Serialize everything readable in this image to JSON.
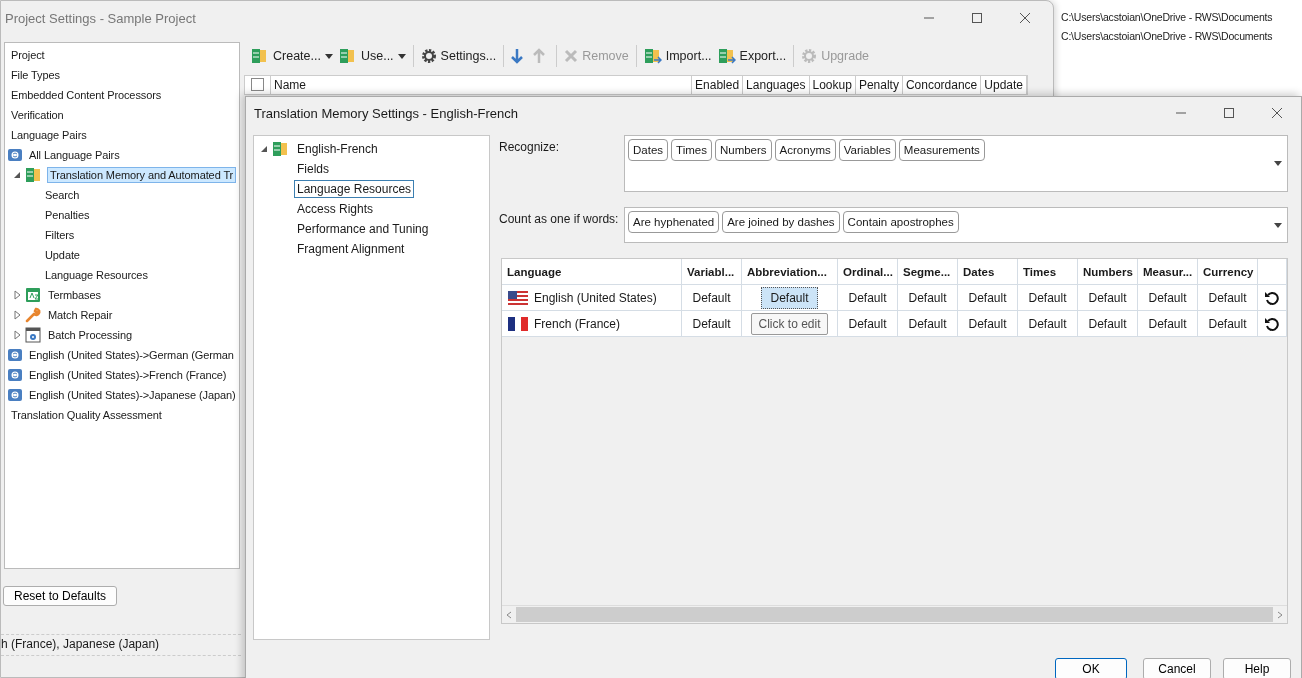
{
  "background_app": {
    "paths": [
      "C:\\Users\\acstoian\\OneDrive - RWS\\Documents",
      "C:\\Users\\acstoian\\OneDrive - RWS\\Documents"
    ]
  },
  "project_window": {
    "title": "Project Settings - Sample Project",
    "nav": [
      {
        "label": "Project",
        "selected": false
      },
      {
        "label": "File Types",
        "selected": false
      },
      {
        "label": "Embedded Content Processors",
        "selected": false
      },
      {
        "label": "Verification",
        "selected": false
      },
      {
        "label": "Language Pairs",
        "selected": false
      },
      {
        "label": "All Language Pairs",
        "kind": "pair",
        "selected": false,
        "children": [
          {
            "label": "Translation Memory and Automated Tr",
            "kind": "memory",
            "selected": true,
            "expanded": true,
            "children": [
              {
                "label": "Search",
                "selected": false
              },
              {
                "label": "Penalties",
                "selected": false
              },
              {
                "label": "Filters",
                "selected": false
              },
              {
                "label": "Update",
                "selected": false
              },
              {
                "label": "Language Resources",
                "selected": false
              }
            ]
          },
          {
            "label": "Termbases",
            "kind": "termbase",
            "selected": false,
            "expanded": false
          },
          {
            "label": "Match Repair",
            "kind": "repair",
            "selected": false,
            "expanded": false
          },
          {
            "label": "Batch Processing",
            "kind": "batch",
            "selected": false,
            "expanded": false
          }
        ]
      },
      {
        "label": "English (United States)->German (German",
        "kind": "pair",
        "selected": false
      },
      {
        "label": "English (United States)->French (France)",
        "kind": "pair",
        "selected": false
      },
      {
        "label": "English (United States)->Japanese (Japan)",
        "kind": "pair",
        "selected": false
      },
      {
        "label": "Translation Quality Assessment",
        "selected": false
      }
    ],
    "reset_button": "Reset to Defaults",
    "footer_text": "h (France), Japanese (Japan)",
    "toolbar": {
      "groups": [
        {
          "items": [
            {
              "label": "Create...",
              "kind": "database",
              "dropdown": true,
              "disabled": false
            },
            {
              "label": "Use...",
              "kind": "database",
              "dropdown": true,
              "disabled": false
            }
          ]
        },
        {
          "items": [
            {
              "label": "Settings...",
              "kind": "gear",
              "dropdown": false,
              "disabled": false
            }
          ]
        },
        {
          "items": [
            {
              "kind": "down",
              "disabled": false
            },
            {
              "kind": "up",
              "disabled": true
            }
          ]
        },
        {
          "items": [
            {
              "label": "Remove",
              "kind": "cross",
              "dropdown": false,
              "disabled": true
            }
          ]
        },
        {
          "items": [
            {
              "label": "Import...",
              "kind": "import",
              "dropdown": false,
              "disabled": false
            },
            {
              "label": "Export...",
              "kind": "export",
              "dropdown": false,
              "disabled": false
            }
          ]
        },
        {
          "items": [
            {
              "label": "Upgrade",
              "kind": "gear",
              "dropdown": false,
              "disabled": true
            }
          ]
        }
      ]
    },
    "grid": {
      "checked": false,
      "columns": [
        "Name",
        "Enabled",
        "Languages",
        "Lookup",
        "Penalty",
        "Concordance",
        "Update"
      ]
    }
  },
  "dialog": {
    "title": "Translation Memory Settings - English-French",
    "tree": {
      "label": "English-French",
      "kind": "memory",
      "selected": false,
      "expanded": true,
      "children": [
        {
          "label": "Fields",
          "selected": false
        },
        {
          "label": "Language Resources",
          "selected": true
        },
        {
          "label": "Access Rights",
          "selected": false
        },
        {
          "label": "Performance and Tuning",
          "selected": false
        },
        {
          "label": "Fragment Alignment",
          "selected": false
        }
      ]
    },
    "recognize": {
      "label": "Recognize:",
      "tags": [
        "Dates",
        "Times",
        "Numbers",
        "Acronyms",
        "Variables",
        "Measurements"
      ]
    },
    "count_as_one": {
      "label": "Count as one if words:",
      "tags": [
        "Are hyphenated",
        "Are joined by dashes",
        "Contain apostrophes"
      ]
    },
    "table": {
      "columns": [
        "Language",
        "Variabl...",
        "Abbreviation...",
        "Ordinal...",
        "Segme...",
        "Dates",
        "Times",
        "Numbers",
        "Measur...",
        "Currency"
      ],
      "rows": [
        {
          "cells": [
            {
              "text": "English (United States)",
              "kind": "language",
              "selected": false
            },
            {
              "text": "Default",
              "kind": "value",
              "selected": false
            },
            {
              "text": "Default",
              "kind": "value",
              "selected": true
            },
            {
              "text": "Default",
              "kind": "value",
              "selected": false
            },
            {
              "text": "Default",
              "kind": "value",
              "selected": false
            },
            {
              "text": "Default",
              "kind": "value",
              "selected": false
            },
            {
              "text": "Default",
              "kind": "value",
              "selected": false
            },
            {
              "text": "Default",
              "kind": "value",
              "selected": false
            },
            {
              "text": "Default",
              "kind": "value",
              "selected": false
            },
            {
              "text": "Default",
              "kind": "value",
              "selected": false
            }
          ]
        },
        {
          "cells": [
            {
              "text": "French (France)",
              "kind": "language",
              "selected": false
            },
            {
              "text": "Default",
              "kind": "value",
              "selected": false
            },
            {
              "text": "Click to edit",
              "kind": "hint",
              "selected": false
            },
            {
              "text": "Default",
              "kind": "value",
              "selected": false
            },
            {
              "text": "Default",
              "kind": "value",
              "selected": false
            },
            {
              "text": "Default",
              "kind": "value",
              "selected": false
            },
            {
              "text": "Default",
              "kind": "value",
              "selected": false
            },
            {
              "text": "Default",
              "kind": "value",
              "selected": false
            },
            {
              "text": "Default",
              "kind": "value",
              "selected": false
            },
            {
              "text": "Default",
              "kind": "value",
              "selected": false
            }
          ]
        }
      ]
    },
    "buttons": [
      "OK",
      "Cancel",
      "Help"
    ]
  }
}
